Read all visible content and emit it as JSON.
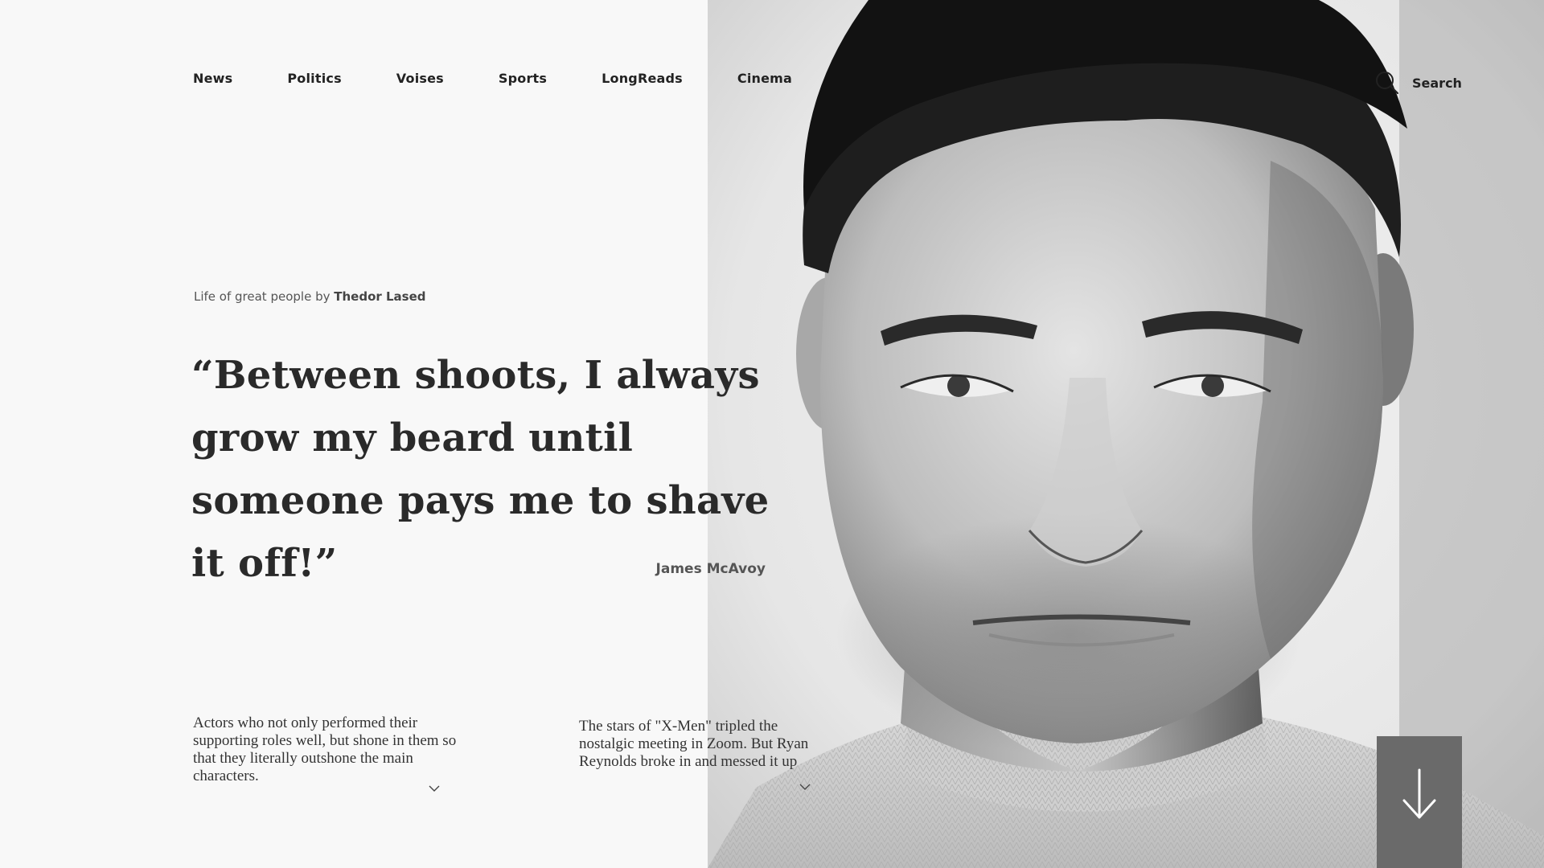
{
  "nav": {
    "items": [
      {
        "label": "News"
      },
      {
        "label": "Politics"
      },
      {
        "label": "Voises"
      },
      {
        "label": "Sports"
      },
      {
        "label": "LongReads"
      },
      {
        "label": "Cinema"
      }
    ]
  },
  "search": {
    "icon": "search-icon",
    "label": "Search"
  },
  "byline": {
    "prefix": "Life of great people by ",
    "author": "Thedor Lased"
  },
  "quote": {
    "text": "“Between shoots, I always grow my beard until someone pays me to shave it off!”",
    "author": "James McAvoy"
  },
  "teasers": [
    {
      "text": "Actors who not only performed their supporting roles well, but shone in them so that they literally outshone the main characters.",
      "icon": "chevron-down-icon"
    },
    {
      "text": "The stars of \"X-Men\" tripled the nostalgic meeting in Zoom. But Ryan Reynolds broke in and messed it up",
      "icon": "chevron-down-icon"
    }
  ],
  "scroll_button": {
    "icon": "arrow-down-icon",
    "color": "#6a6a6a"
  },
  "hero_image": {
    "subject": "black-and-white portrait of a man"
  }
}
